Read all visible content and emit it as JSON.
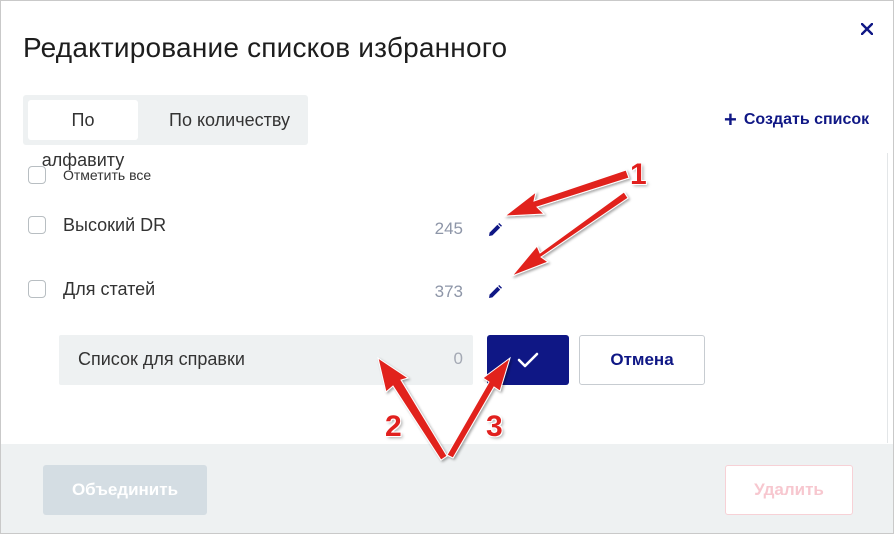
{
  "dialog": {
    "title": "Редактирование списков избранного"
  },
  "tabs": [
    {
      "label": "По алфавиту",
      "active": true
    },
    {
      "label": "По количеству",
      "active": false
    }
  ],
  "create_label": "Создать список",
  "select_all_label": "Отметить все",
  "lists": [
    {
      "name": "Высокий DR",
      "count": "245"
    },
    {
      "name": "Для статей",
      "count": "373"
    }
  ],
  "editing": {
    "value": "Список для справки",
    "count": "0",
    "cancel_label": "Отмена"
  },
  "footer": {
    "merge_label": "Объединить",
    "delete_label": "Удалить"
  },
  "annotations": [
    "1",
    "2",
    "3"
  ],
  "colors": {
    "accent": "#0f1785",
    "annotation": "#e1201e",
    "panel": "#eef1f2"
  }
}
